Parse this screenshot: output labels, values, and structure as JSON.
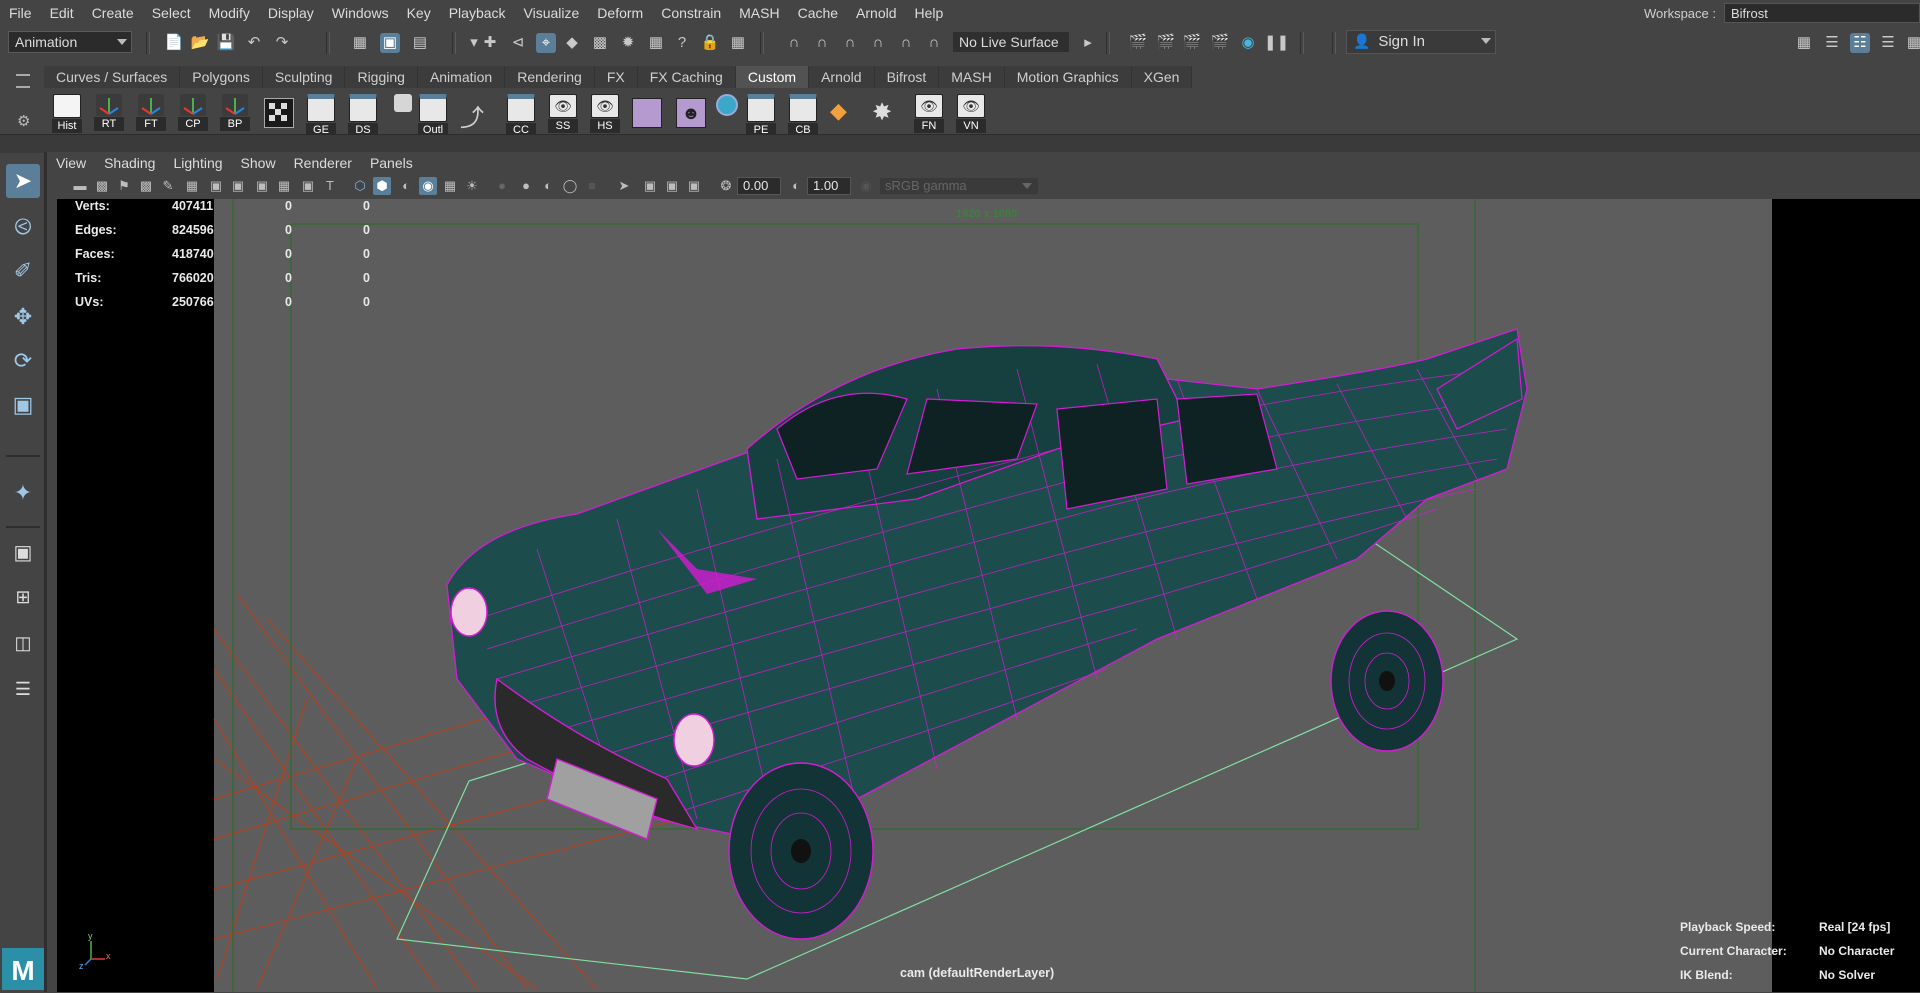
{
  "menubar": {
    "items": [
      "File",
      "Edit",
      "Create",
      "Select",
      "Modify",
      "Display",
      "Windows",
      "Key",
      "Playback",
      "Visualize",
      "Deform",
      "Constrain",
      "MASH",
      "Cache",
      "Arnold",
      "Help"
    ],
    "workspace_label": "Workspace :",
    "workspace_value": "Bifrost"
  },
  "statusline": {
    "menuset": "Animation",
    "live_surface": "No Live Surface",
    "sign_in": "Sign In"
  },
  "shelf": {
    "tabs": [
      "Curves / Surfaces",
      "Polygons",
      "Sculpting",
      "Rigging",
      "Animation",
      "Rendering",
      "FX",
      "FX Caching",
      "Custom",
      "Arnold",
      "Bifrost",
      "MASH",
      "Motion Graphics",
      "XGen"
    ],
    "active_tab": "Custom",
    "buttons": [
      "Hist",
      "RT",
      "FT",
      "CP",
      "BP",
      "GE",
      "DS",
      "Outl",
      "CC",
      "SS",
      "HS",
      "PE",
      "CB",
      "FN",
      "VN"
    ]
  },
  "panel": {
    "menus": [
      "View",
      "Shading",
      "Lighting",
      "Show",
      "Renderer",
      "Panels"
    ],
    "exposure": "0.00",
    "gamma": "1.00",
    "color_space": "sRGB gamma"
  },
  "hud": {
    "stats": [
      {
        "label": "Verts:",
        "a": "407411",
        "b": "0",
        "c": "0"
      },
      {
        "label": "Edges:",
        "a": "824596",
        "b": "0",
        "c": "0"
      },
      {
        "label": "Faces:",
        "a": "418740",
        "b": "0",
        "c": "0"
      },
      {
        "label": "Tris:",
        "a": "766020",
        "b": "0",
        "c": "0"
      },
      {
        "label": "UVs:",
        "a": "250766",
        "b": "0",
        "c": "0"
      }
    ],
    "resolution": "1920 x 1080",
    "camera": "cam (defaultRenderLayer)",
    "playback_speed_label": "Playback Speed:",
    "playback_speed_value": "Real [24 fps]",
    "current_character_label": "Current Character:",
    "current_character_value": "No Character",
    "ik_blend_label": "IK Blend:",
    "ik_blend_value": "No Solver",
    "axis_x": "x",
    "axis_y": "y",
    "axis_z": "z"
  },
  "colors": {
    "wire": "#d41cd4",
    "shaded": "#1d4c4c",
    "viewport_bg": "#5d5d5d",
    "gate_green": "#2a6e2a",
    "active_blue": "#5b7f99"
  }
}
